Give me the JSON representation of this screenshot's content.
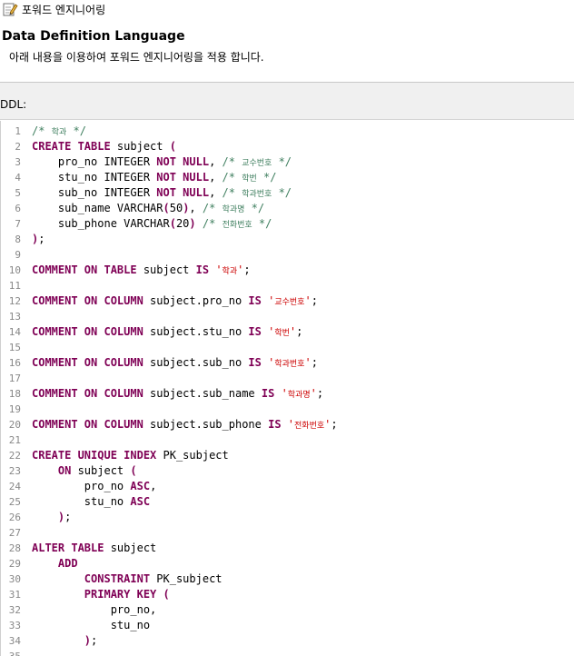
{
  "window": {
    "title": "포워드 엔지니어링"
  },
  "header": {
    "title": "Data Definition Language",
    "description": "아래 내용을 이용하여 포워드 엔지니어링을 적용 합니다."
  },
  "ddl_label": "DDL:",
  "lines": [
    [
      [
        "c",
        "/* "
      ],
      [
        "cs",
        "학과"
      ],
      [
        "c",
        " */"
      ]
    ],
    [
      [
        "k",
        "CREATE TABLE"
      ],
      [
        "t",
        " subject "
      ],
      [
        "p",
        "("
      ]
    ],
    [
      [
        "t",
        "    pro_no INTEGER "
      ],
      [
        "k",
        "NOT NULL"
      ],
      [
        "t",
        ", "
      ],
      [
        "c",
        "/* "
      ],
      [
        "cs",
        "교수번호"
      ],
      [
        "c",
        " */"
      ]
    ],
    [
      [
        "t",
        "    stu_no INTEGER "
      ],
      [
        "k",
        "NOT NULL"
      ],
      [
        "t",
        ", "
      ],
      [
        "c",
        "/* "
      ],
      [
        "cs",
        "학번"
      ],
      [
        "c",
        " */"
      ]
    ],
    [
      [
        "t",
        "    sub_no INTEGER "
      ],
      [
        "k",
        "NOT NULL"
      ],
      [
        "t",
        ", "
      ],
      [
        "c",
        "/* "
      ],
      [
        "cs",
        "학과번호"
      ],
      [
        "c",
        " */"
      ]
    ],
    [
      [
        "t",
        "    sub_name VARCHAR"
      ],
      [
        "p",
        "("
      ],
      [
        "t",
        "50"
      ],
      [
        "p",
        ")"
      ],
      [
        "t",
        ", "
      ],
      [
        "c",
        "/* "
      ],
      [
        "cs",
        "학과명"
      ],
      [
        "c",
        " */"
      ]
    ],
    [
      [
        "t",
        "    sub_phone VARCHAR"
      ],
      [
        "p",
        "("
      ],
      [
        "t",
        "20"
      ],
      [
        "p",
        ")"
      ],
      [
        "t",
        " "
      ],
      [
        "c",
        "/* "
      ],
      [
        "cs",
        "전화번호"
      ],
      [
        "c",
        " */"
      ]
    ],
    [
      [
        "p",
        ")"
      ],
      [
        "t",
        ";"
      ]
    ],
    [],
    [
      [
        "k",
        "COMMENT ON TABLE"
      ],
      [
        "t",
        " subject "
      ],
      [
        "k",
        "IS"
      ],
      [
        "t",
        " "
      ],
      [
        "s",
        "'"
      ],
      [
        "ss",
        "학과"
      ],
      [
        "s",
        "'"
      ],
      [
        "t",
        ";"
      ]
    ],
    [],
    [
      [
        "k",
        "COMMENT ON COLUMN"
      ],
      [
        "t",
        " subject.pro_no "
      ],
      [
        "k",
        "IS"
      ],
      [
        "t",
        " "
      ],
      [
        "s",
        "'"
      ],
      [
        "ss",
        "교수번호"
      ],
      [
        "s",
        "'"
      ],
      [
        "t",
        ";"
      ]
    ],
    [],
    [
      [
        "k",
        "COMMENT ON COLUMN"
      ],
      [
        "t",
        " subject.stu_no "
      ],
      [
        "k",
        "IS"
      ],
      [
        "t",
        " "
      ],
      [
        "s",
        "'"
      ],
      [
        "ss",
        "학번"
      ],
      [
        "s",
        "'"
      ],
      [
        "t",
        ";"
      ]
    ],
    [],
    [
      [
        "k",
        "COMMENT ON COLUMN"
      ],
      [
        "t",
        " subject.sub_no "
      ],
      [
        "k",
        "IS"
      ],
      [
        "t",
        " "
      ],
      [
        "s",
        "'"
      ],
      [
        "ss",
        "학과번호"
      ],
      [
        "s",
        "'"
      ],
      [
        "t",
        ";"
      ]
    ],
    [],
    [
      [
        "k",
        "COMMENT ON COLUMN"
      ],
      [
        "t",
        " subject.sub_name "
      ],
      [
        "k",
        "IS"
      ],
      [
        "t",
        " "
      ],
      [
        "s",
        "'"
      ],
      [
        "ss",
        "학과명"
      ],
      [
        "s",
        "'"
      ],
      [
        "t",
        ";"
      ]
    ],
    [],
    [
      [
        "k",
        "COMMENT ON COLUMN"
      ],
      [
        "t",
        " subject.sub_phone "
      ],
      [
        "k",
        "IS"
      ],
      [
        "t",
        " "
      ],
      [
        "s",
        "'"
      ],
      [
        "ss",
        "전화번호"
      ],
      [
        "s",
        "'"
      ],
      [
        "t",
        ";"
      ]
    ],
    [],
    [
      [
        "k",
        "CREATE UNIQUE INDEX"
      ],
      [
        "t",
        " PK_subject"
      ]
    ],
    [
      [
        "t",
        "    "
      ],
      [
        "k",
        "ON"
      ],
      [
        "t",
        " subject "
      ],
      [
        "p",
        "("
      ]
    ],
    [
      [
        "t",
        "        pro_no "
      ],
      [
        "k",
        "ASC"
      ],
      [
        "t",
        ","
      ]
    ],
    [
      [
        "t",
        "        stu_no "
      ],
      [
        "k",
        "ASC"
      ]
    ],
    [
      [
        "t",
        "    "
      ],
      [
        "p",
        ")"
      ],
      [
        "t",
        ";"
      ]
    ],
    [],
    [
      [
        "k",
        "ALTER TABLE"
      ],
      [
        "t",
        " subject"
      ]
    ],
    [
      [
        "t",
        "    "
      ],
      [
        "k",
        "ADD"
      ]
    ],
    [
      [
        "t",
        "        "
      ],
      [
        "k",
        "CONSTRAINT"
      ],
      [
        "t",
        " PK_subject"
      ]
    ],
    [
      [
        "t",
        "        "
      ],
      [
        "k",
        "PRIMARY KEY"
      ],
      [
        "t",
        " "
      ],
      [
        "p",
        "("
      ]
    ],
    [
      [
        "t",
        "            pro_no,"
      ]
    ],
    [
      [
        "t",
        "            stu_no"
      ]
    ],
    [
      [
        "t",
        "        "
      ],
      [
        "p",
        ")"
      ],
      [
        "t",
        ";"
      ]
    ],
    []
  ],
  "line_numbers": [
    "1",
    "2",
    "3",
    "4",
    "5",
    "6",
    "7",
    "8",
    "9",
    "10",
    "11",
    "12",
    "13",
    "14",
    "15",
    "16",
    "17",
    "18",
    "19",
    "20",
    "21",
    "22",
    "23",
    "24",
    "25",
    "26",
    "27",
    "28",
    "29",
    "30",
    "31",
    "32",
    "33",
    "34",
    "35"
  ],
  "icons": {
    "window": "edit-document-icon"
  }
}
